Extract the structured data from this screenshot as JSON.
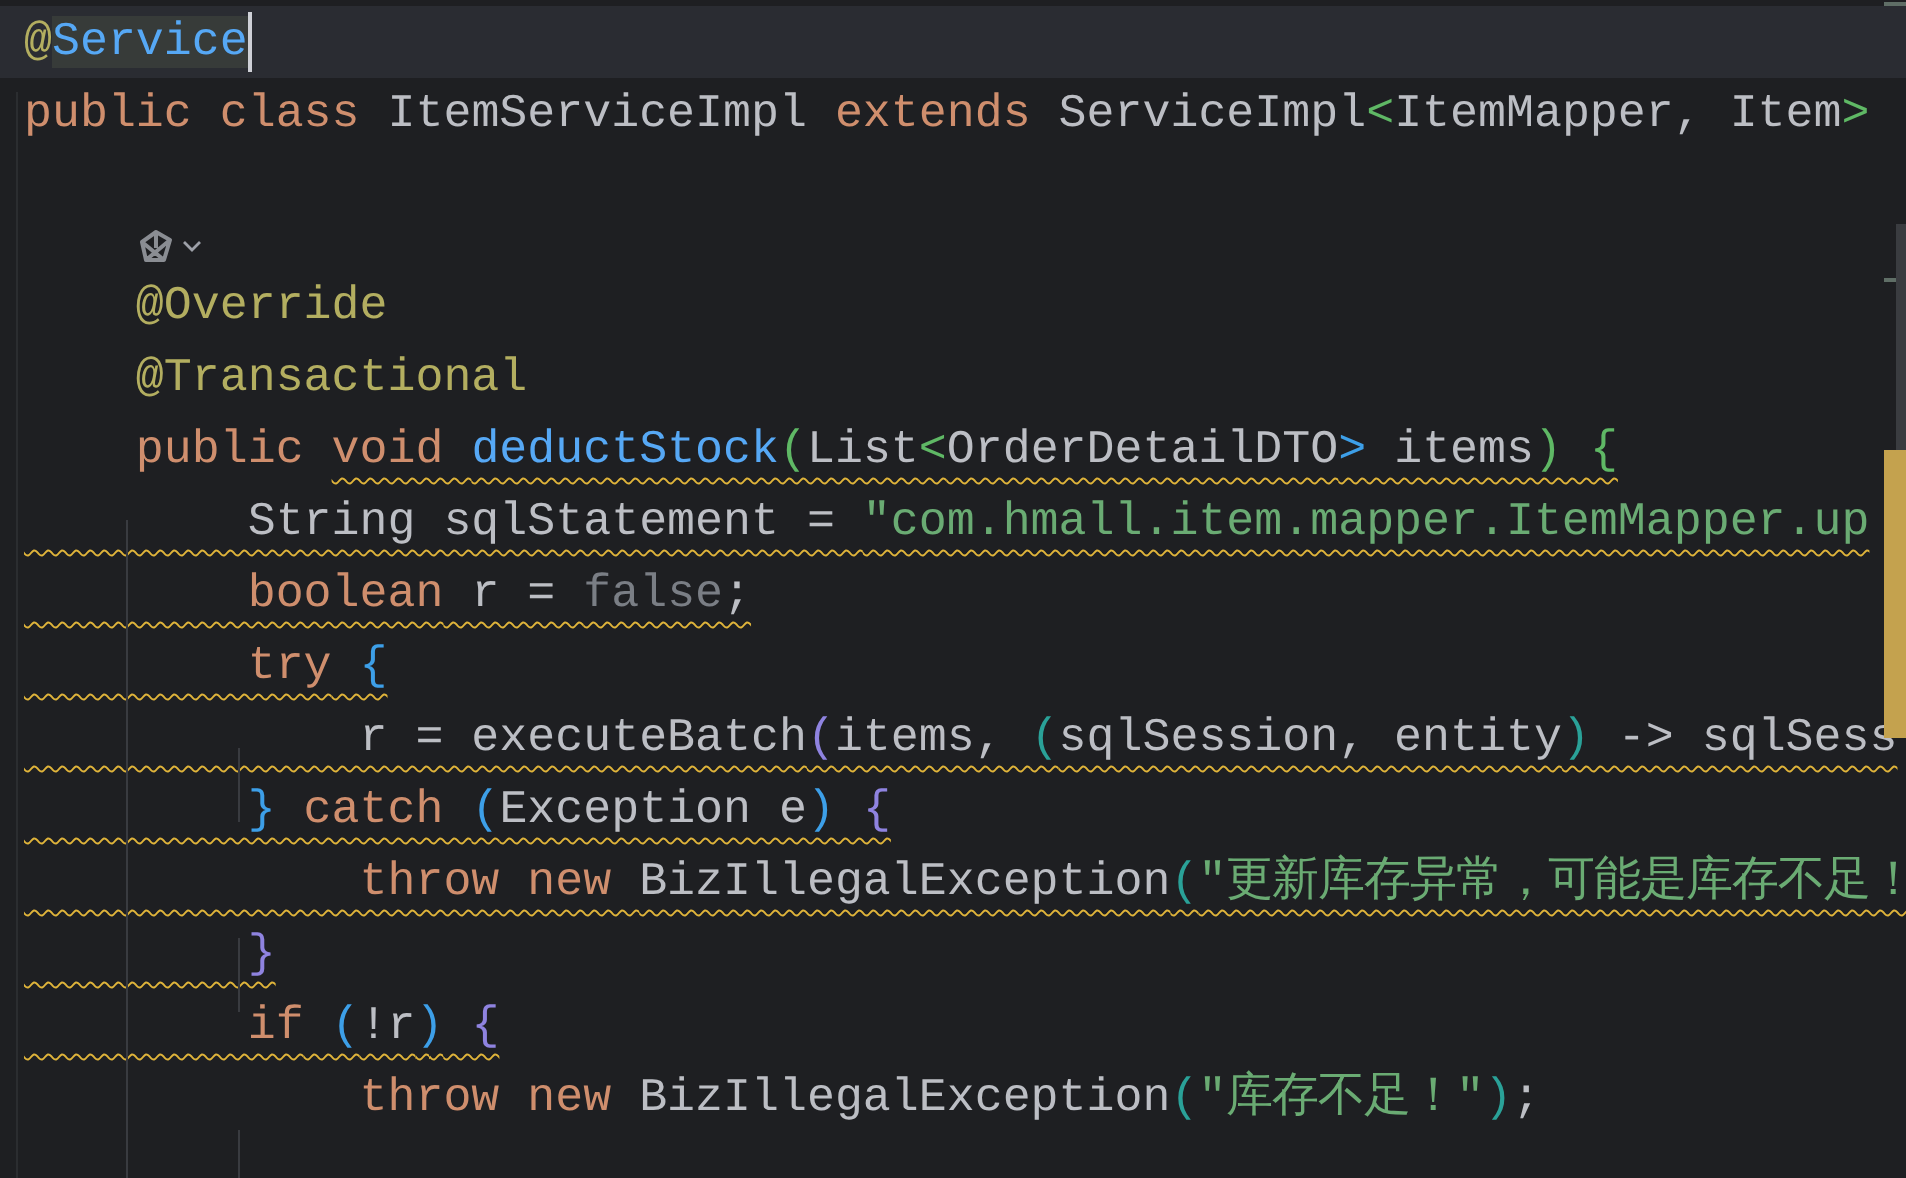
{
  "editor": {
    "lines": [
      {
        "kind": "code",
        "current": true,
        "tokens": [
          {
            "text": "@",
            "kind": "annotation"
          },
          {
            "text": "Service",
            "kind": "annotation-selected"
          }
        ]
      },
      {
        "kind": "code",
        "tokens": [
          {
            "text": "public class ",
            "kind": "keyword"
          },
          {
            "text": "ItemServiceImpl ",
            "kind": "plain"
          },
          {
            "text": "extends",
            "kind": "keyword"
          },
          {
            "text": " ServiceImpl",
            "kind": "plain"
          },
          {
            "text": "<",
            "kind": "angle-green"
          },
          {
            "text": "ItemMapper, Item",
            "kind": "plain"
          },
          {
            "text": ">",
            "kind": "angle-green"
          }
        ]
      },
      {
        "kind": "blank"
      },
      {
        "kind": "hint"
      },
      {
        "kind": "code",
        "tokens": [
          {
            "text": "    @Override",
            "kind": "annotation"
          }
        ]
      },
      {
        "kind": "code",
        "tokens": [
          {
            "text": "    @Transactional",
            "kind": "annotation"
          }
        ]
      },
      {
        "kind": "code",
        "tokens": [
          {
            "text": "    public ",
            "kind": "keyword"
          }
        ],
        "warned_tokens": [
          {
            "text": "void ",
            "kind": "keyword"
          },
          {
            "text": "deductStock",
            "kind": "method"
          },
          {
            "text": "(",
            "kind": "paren-green"
          },
          {
            "text": "List",
            "kind": "plain"
          },
          {
            "text": "<",
            "kind": "angle-green"
          },
          {
            "text": "OrderDetailDTO",
            "kind": "plain"
          },
          {
            "text": ">",
            "kind": "angle-blue"
          },
          {
            "text": " items",
            "kind": "plain"
          },
          {
            "text": ")",
            "kind": "paren-green"
          },
          {
            "text": " {",
            "kind": "paren-green"
          }
        ]
      },
      {
        "kind": "code",
        "warned_tokens": [
          {
            "text": "        String sqlStatement = ",
            "kind": "plain"
          },
          {
            "text": "\"com.hmall.item.mapper.ItemMapper.up",
            "kind": "string"
          }
        ]
      },
      {
        "kind": "code",
        "warned_tokens": [
          {
            "text": "        boolean",
            "kind": "keyword"
          },
          {
            "text": " r = ",
            "kind": "plain"
          },
          {
            "text": "false",
            "kind": "dim"
          },
          {
            "text": ";",
            "kind": "plain"
          }
        ]
      },
      {
        "kind": "code",
        "warned_tokens": [
          {
            "text": "        try",
            "kind": "keyword"
          },
          {
            "text": " {",
            "kind": "paren-blue"
          }
        ]
      },
      {
        "kind": "code",
        "warned_tokens": [
          {
            "text": "            r = executeBatch",
            "kind": "plain"
          },
          {
            "text": "(",
            "kind": "paren-purple"
          },
          {
            "text": "items, ",
            "kind": "plain"
          },
          {
            "text": "(",
            "kind": "paren-teal"
          },
          {
            "text": "sqlSession, entity",
            "kind": "plain"
          },
          {
            "text": ")",
            "kind": "paren-teal"
          },
          {
            "text": " -> sqlSess",
            "kind": "plain"
          }
        ]
      },
      {
        "kind": "code",
        "warned_tokens": [
          {
            "text": "        }",
            "kind": "paren-blue"
          },
          {
            "text": " catch ",
            "kind": "keyword"
          },
          {
            "text": "(",
            "kind": "paren-blue"
          },
          {
            "text": "Exception e",
            "kind": "plain"
          },
          {
            "text": ")",
            "kind": "paren-blue"
          },
          {
            "text": " {",
            "kind": "paren-purple"
          }
        ]
      },
      {
        "kind": "code",
        "warned_tokens": [
          {
            "text": "            throw new ",
            "kind": "keyword"
          },
          {
            "text": "BizIllegalException",
            "kind": "plain"
          },
          {
            "text": "(",
            "kind": "paren-teal"
          },
          {
            "text": "\"更新库存异常，可能是库存不足！",
            "kind": "string"
          }
        ]
      },
      {
        "kind": "code",
        "warned_tokens": [
          {
            "text": "        }",
            "kind": "paren-purple"
          }
        ]
      },
      {
        "kind": "code",
        "warned_tokens": [
          {
            "text": "        if",
            "kind": "keyword"
          },
          {
            "text": " (",
            "kind": "paren-blue"
          },
          {
            "text": "!r",
            "kind": "plain"
          },
          {
            "text": ")",
            "kind": "paren-blue"
          },
          {
            "text": " {",
            "kind": "paren-purple"
          }
        ]
      },
      {
        "kind": "code",
        "tokens": [
          {
            "text": "            throw new ",
            "kind": "keyword"
          },
          {
            "text": "BizIllegalException",
            "kind": "plain"
          },
          {
            "text": "(",
            "kind": "paren-teal"
          },
          {
            "text": "\"库存不足！\"",
            "kind": "string"
          },
          {
            "text": ")",
            "kind": "paren-teal"
          },
          {
            "text": ";",
            "kind": "plain"
          }
        ]
      }
    ]
  }
}
